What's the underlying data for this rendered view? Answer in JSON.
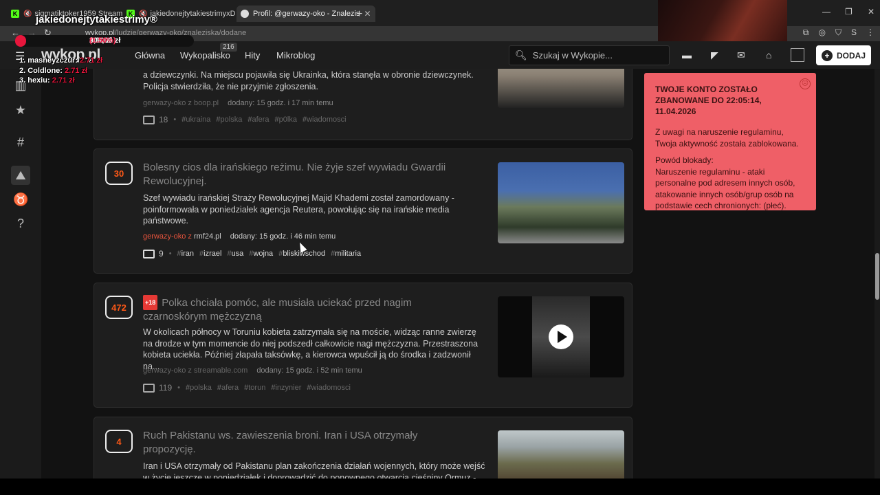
{
  "browser": {
    "tabs": [
      {
        "title": "sigmatiktoker1959 Stream"
      },
      {
        "title": "jakiedonejtytakiestrimyxD S"
      },
      {
        "title": "Profil: @gerwazy-oko - Znalezis"
      }
    ],
    "new_tab": "+",
    "url_host": "wykop.pl",
    "url_path": "/ludzie/gerwazy-oko/znaleziska/dodane"
  },
  "overlay": {
    "title": "jakiedonejtytakiestrimy®",
    "goal_current": "3,00 zł",
    "goal_sep": "z",
    "goal_target": "200,00 zł",
    "goal_percent": "(1.50%)",
    "goal_fraction": 0.015,
    "ranking": [
      {
        "label": "1. masneyzczur:",
        "amount": "2.71 zł"
      },
      {
        "label": "2. Coldlone:",
        "amount": "2.71 zł"
      },
      {
        "label": "3. hexiu:",
        "amount": "2.71 zł"
      }
    ]
  },
  "header": {
    "logo": "wykop.pl",
    "nav": [
      {
        "label": "Główna"
      },
      {
        "label": "Wykopalisko",
        "badge": "216"
      },
      {
        "label": "Hity"
      },
      {
        "label": "Mikroblog"
      }
    ],
    "search_placeholder": "Szukaj w Wykopie...",
    "add_button": "DODAJ"
  },
  "sidebar": {
    "icons": [
      "menu-icon",
      "fire-icon",
      "star-icon",
      "hashtag-icon",
      "podium-icon",
      "medal-icon",
      "help-icon"
    ]
  },
  "posts": [
    {
      "votes": "",
      "title": "",
      "desc": "a dziewczynki. Na miejscu pojawiła się Ukrainka, która stanęła w obronie dziewczynek. Policja stwierdziła, że nie przyjmie zgłoszenia.",
      "author": "gerwazy-oko",
      "source_prefix": "z",
      "source": "boop.pl",
      "added": "dodany: 15 godz. i 17 min temu",
      "comments": "18",
      "tags": [
        "ukraina",
        "polska",
        "afera",
        "p0lka",
        "wiadomosci"
      ]
    },
    {
      "votes": "30",
      "title": "Bolesny cios dla irańskiego reżimu. Nie żyje szef wywiadu Gwardii Rewolucyjnej.",
      "desc": "Szef wywiadu irańskiej Straży Rewolucyjnej Majid Khademi został zamordowany - poinformowała w poniedziałek agencja Reutera, powołując się na irańskie media państwowe.",
      "author": "gerwazy-oko",
      "source_prefix": "z",
      "source": "rmf24.pl",
      "added": "dodany: 15 godz. i 46 min temu",
      "comments": "9",
      "tags": [
        "iran",
        "izrael",
        "usa",
        "wojna",
        "bliskiwschod",
        "militaria"
      ]
    },
    {
      "votes": "472",
      "badge": "+18",
      "title": "Polka chciała pomóc, ale musiała uciekać przed nagim czarnoskórym mężczyzną",
      "desc": "W okolicach północy w Toruniu kobieta zatrzymała się na moście, widząc ranne zwierzę na drodze w tym momencie do niej podszedł całkowicie nagi mężczyzna. Przestraszona kobieta uciekła. Później złapała taksówkę, a kierowca wpuścił ją do środka i zadzwonił na...",
      "author": "gerwazy-oko",
      "source_prefix": "z",
      "source": "streamable.com",
      "added": "dodany: 15 godz. i 52 min temu",
      "comments": "119",
      "tags": [
        "polska",
        "afera",
        "torun",
        "inzynier",
        "wiadomosci"
      ]
    },
    {
      "votes": "4",
      "title": "Ruch Pakistanu ws. zawieszenia broni. Iran i USA otrzymały propozycję.",
      "desc": "Iran i USA otrzymały od Pakistanu plan zakończenia działań wojennych, który może wejść w życie jeszcze w poniedziałek i doprowadzić do ponownego otwarcia cieśniny Ormuz -"
    }
  ],
  "ban_notice": {
    "title": "TWOJE KONTO ZOSTAŁO ZBANOWANE DO 22:05:14, 11.04.2026",
    "line1": "Z uwagi na naruszenie regulaminu, Twoja aktywność została zablokowana.",
    "reason_label": "Powód blokady:",
    "reason": "Naruszenie regulaminu - ataki personalne pod adresem innych osób, atakowanie innych osób/grup osób na podstawie cech chronionych: (płeć).",
    "bg_color": "#ef5f67"
  }
}
